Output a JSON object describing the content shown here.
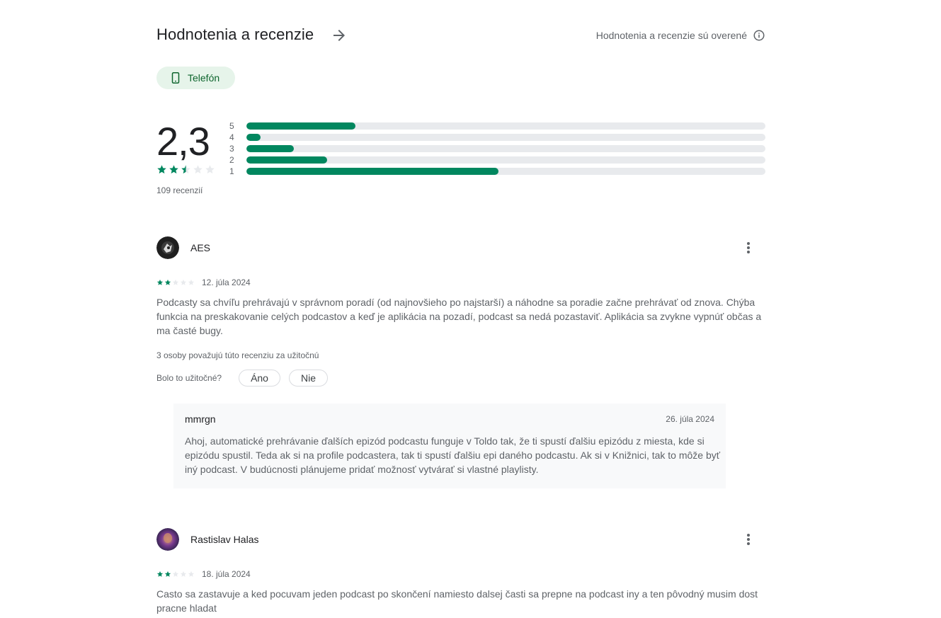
{
  "header": {
    "title": "Hodnotenia a recenzie",
    "verified_text": "Hodnotenia a recenzie sú overené"
  },
  "device_chip": {
    "label": "Telefón",
    "icon": "phone-icon"
  },
  "summary": {
    "score": "2,3",
    "stars": 2.5,
    "review_count": "109 recenzií",
    "distribution": [
      {
        "label": "5",
        "fraction": 0.21
      },
      {
        "label": "4",
        "fraction": 0.027
      },
      {
        "label": "3",
        "fraction": 0.091
      },
      {
        "label": "2",
        "fraction": 0.155
      },
      {
        "label": "1",
        "fraction": 0.485
      }
    ]
  },
  "reviews": [
    {
      "author": "AES",
      "stars": 2,
      "date": "12. júla 2024",
      "text": "Podcasty sa chvíľu prehrávajú v správnom poradí (od najnovšieho po najstarší) a náhodne sa poradie začne prehrávať od znova. Chýba funkcia na preskakovanie celých podcastov a keď je aplikácia na pozadí, podcast sa nedá pozastaviť. Aplikácia sa zvykne vypnúť občas a ma časté bugy.",
      "helpful_count": "3 osoby považujú túto recenziu za užitočnú",
      "helpful_question": "Bolo to užitočné?",
      "yes_label": "Áno",
      "no_label": "Nie",
      "reply": {
        "author": "mmrgn",
        "date": "26. júla 2024",
        "text": "Ahoj, automatické prehrávanie ďalších epizód podcastu funguje v Toldo tak, že ti spustí ďalšiu epizódu z miesta, kde si epizódu spustil. Teda ak si na profile podcastera, tak ti spustí ďalšiu epi daného podcastu. Ak si v Knižnici, tak to môže byť iný podcast. V budúcnosti plánujeme pridať možnosť vytvárať si vlastné playlisty."
      }
    },
    {
      "author": "Rastislav Halas",
      "stars": 2,
      "date": "18. júla 2024",
      "text": "Casto sa zastavuje a ked pocuvam jeden podcast po skončení namiesto dalsej časti sa prepne na podcast iny a ten pôvodný musim dost pracne hladat"
    }
  ],
  "colors": {
    "accent": "#01875f",
    "track": "#e8eaed",
    "chip_bg": "#e6f4ea"
  }
}
